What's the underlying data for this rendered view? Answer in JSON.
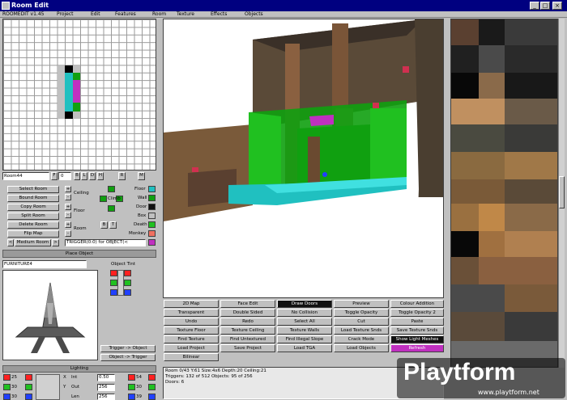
{
  "window": {
    "title": "Room Edit"
  },
  "menu": {
    "app": "ROOMEDIT v1.45",
    "items": [
      "Project",
      "Edit",
      "Features",
      "Room",
      "Texture",
      "Effects",
      "Objects"
    ]
  },
  "room": {
    "name": "Room44",
    "flip_buttons": [
      "F",
      "0",
      "B",
      "L",
      "D",
      "H",
      "R",
      "M"
    ],
    "buttons": [
      "Select Room",
      "Bound Room",
      "Copy Room",
      "Split Room",
      "Delete Room",
      "Flip Map"
    ],
    "prev": "<",
    "next": ">",
    "current": "Medium Room",
    "labels": {
      "ceiling": "Ceiling",
      "floor": "Floor",
      "room": "Room",
      "climb": "Climb"
    },
    "b_label": "B",
    "t_label": "T",
    "trigger_text": "TRIGGER(0:0) for OBJECT(<"
  },
  "sector_types": [
    {
      "label": "Floor",
      "color": "#20c0c0"
    },
    {
      "label": "Wall",
      "color": "#10a010"
    },
    {
      "label": "Door",
      "color": "#101010"
    },
    {
      "label": "Box",
      "color": "#c0c0c0"
    },
    {
      "label": "Death",
      "color": "#20c020"
    },
    {
      "label": "Monkey",
      "color": "#f07060"
    },
    {
      "label": "Trigger",
      "color": "#c030c0"
    }
  ],
  "object": {
    "place_label": "Place Object",
    "name": "FURNITURE4",
    "tint_label": "Object Tint",
    "trigger_to_object": "Trigger -> Object",
    "object_to_trigger": "Object -> Trigger"
  },
  "lighting": {
    "header": "Lighting",
    "rgb_left": [
      "25",
      "30",
      "30"
    ],
    "rgb_right": [
      "54",
      "30",
      "39"
    ],
    "labels": [
      "Int",
      "Out",
      "Len"
    ],
    "axes": [
      "X",
      "Y"
    ],
    "values": [
      "0.50",
      "256",
      "256"
    ]
  },
  "toolbar": [
    [
      "2D Map",
      "Face Edit",
      "Draw Doors",
      "Preview",
      "Colour Addition"
    ],
    [
      "Transparent",
      "Double Sided",
      "No Collision",
      "Toggle Opacity",
      "Toggle Opacity 2"
    ],
    [
      "Undo",
      "Redo",
      "Select All",
      "Cut",
      "Paste"
    ],
    [
      "Texture Floor",
      "Texture Ceiling",
      "Texture Walls",
      "Load Texture Snds",
      "Save Texture Snds"
    ],
    [
      "Find Texture",
      "Find Untextured",
      "Find Illegal Slope",
      "Crack Mode",
      "Show Light Meshes"
    ],
    [
      "Load Project",
      "Save Project",
      "Load TGA",
      "Load Objects",
      "Refresh"
    ],
    [
      "Bilinear",
      "",
      "",
      "",
      ""
    ]
  ],
  "status": {
    "line1": "Room 0/43 Y:61     Size:4x6     Depth:20  Ceiling:21",
    "line2": "Triggers: 132 of 512  Objects: 95 of 256",
    "line3": "Doors: 6"
  },
  "watermark": {
    "brand": "Playtform",
    "url": "www.playtform.net"
  },
  "colors": {
    "grid_bg": "#ffffff",
    "viewport_bg": "#ffffff",
    "accent_magenta": "#c030c0",
    "floor_cyan": "#20c0c0",
    "wall_green": "#10a010"
  }
}
